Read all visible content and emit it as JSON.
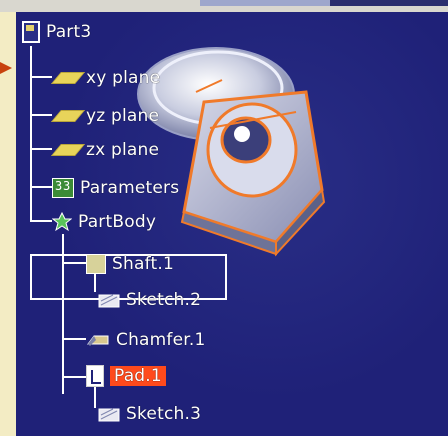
{
  "tree": {
    "root": {
      "label": "Part3",
      "icon": "part-icon"
    },
    "children": [
      {
        "label": "xy plane",
        "icon": "plane-icon"
      },
      {
        "label": "yz plane",
        "icon": "plane-icon"
      },
      {
        "label": "zx plane",
        "icon": "plane-icon"
      },
      {
        "label": "Parameters",
        "icon": "parameters-icon"
      },
      {
        "label": "PartBody",
        "icon": "partbody-icon"
      }
    ],
    "partbody_children": [
      {
        "label": "Shaft.1",
        "icon": "shaft-icon"
      },
      {
        "label": "Sketch.2",
        "icon": "sketch-icon"
      },
      {
        "label": "Chamfer.1",
        "icon": "chamfer-icon"
      },
      {
        "label": "Pad.1",
        "icon": "pad-icon"
      },
      {
        "label": "Sketch.3",
        "icon": "sketch-icon"
      }
    ]
  },
  "colors": {
    "viewport_bg": "#1f2178",
    "highlight": "#ff4a1c",
    "plane_yellow": "#e8d45a",
    "orange_outline": "#f07a2a"
  }
}
